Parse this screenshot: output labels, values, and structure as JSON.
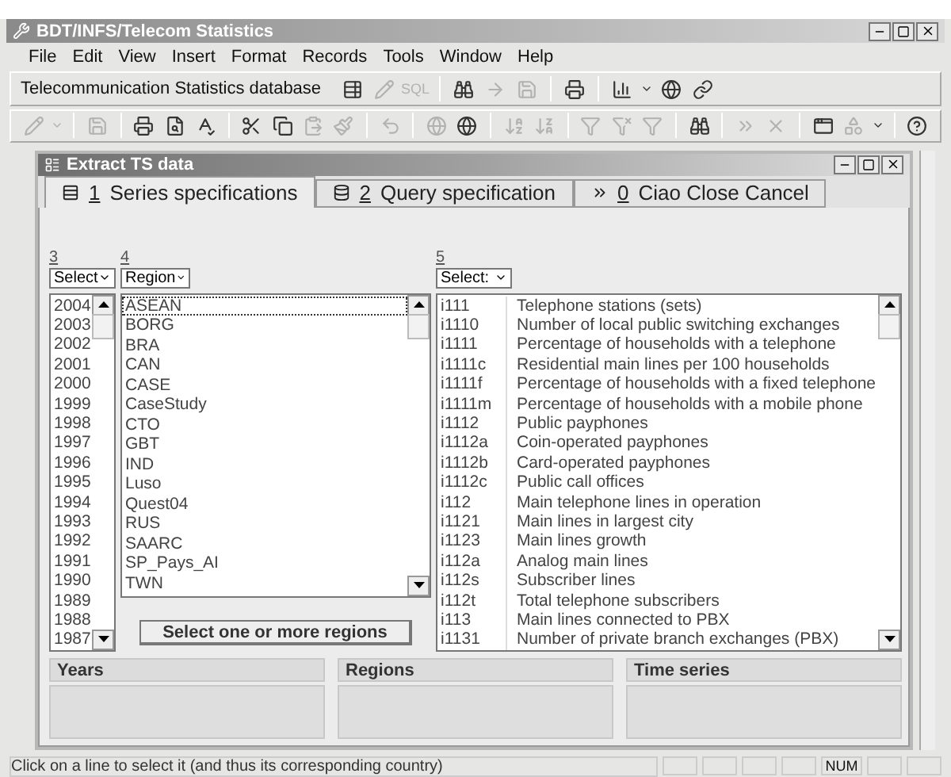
{
  "window": {
    "title": "BDT/INFS/Telecom Statistics"
  },
  "menu": [
    "File",
    "Edit",
    "View",
    "Insert",
    "Format",
    "Records",
    "Tools",
    "Window",
    "Help"
  ],
  "toolbar_1": {
    "label": "Telecommunication Statistics database",
    "items": [
      {
        "kind": "sigma",
        "disabled": false
      },
      {
        "kind": "pencil",
        "disabled": true
      },
      {
        "kind": "text",
        "label": "SQL",
        "disabled": true
      },
      {
        "kind": "separator"
      },
      {
        "kind": "binoculars",
        "disabled": false
      },
      {
        "kind": "arrow",
        "disabled": true
      },
      {
        "kind": "save",
        "disabled": true
      },
      {
        "kind": "separator"
      },
      {
        "kind": "printer",
        "disabled": false
      },
      {
        "kind": "separator"
      },
      {
        "kind": "chart",
        "disabled": false
      },
      {
        "kind": "caret",
        "disabled": false
      },
      {
        "kind": "globe",
        "disabled": false
      },
      {
        "kind": "link",
        "disabled": false
      }
    ]
  },
  "toolbar_2": {
    "items": [
      {
        "kind": "pencil",
        "disabled": true
      },
      {
        "kind": "caret",
        "disabled": true
      },
      {
        "kind": "separator"
      },
      {
        "kind": "save",
        "disabled": true
      },
      {
        "kind": "separator"
      },
      {
        "kind": "printer",
        "disabled": false
      },
      {
        "kind": "preview",
        "disabled": false
      },
      {
        "kind": "spell",
        "disabled": false
      },
      {
        "kind": "separator"
      },
      {
        "kind": "cut",
        "disabled": false
      },
      {
        "kind": "copy",
        "disabled": false
      },
      {
        "kind": "paste",
        "disabled": true
      },
      {
        "kind": "brush",
        "disabled": true
      },
      {
        "kind": "separator"
      },
      {
        "kind": "undo",
        "disabled": true
      },
      {
        "kind": "separator"
      },
      {
        "kind": "globe",
        "disabled": true
      },
      {
        "kind": "globe",
        "disabled": false
      },
      {
        "kind": "separator"
      },
      {
        "kind": "sort-az",
        "disabled": true
      },
      {
        "kind": "sort-za",
        "disabled": true
      },
      {
        "kind": "separator"
      },
      {
        "kind": "filter",
        "disabled": true
      },
      {
        "kind": "filter-form",
        "disabled": true
      },
      {
        "kind": "filter",
        "disabled": true
      },
      {
        "kind": "separator"
      },
      {
        "kind": "binoculars",
        "disabled": false
      },
      {
        "kind": "separator"
      },
      {
        "kind": "record-new",
        "disabled": true
      },
      {
        "kind": "record-delete",
        "disabled": true
      },
      {
        "kind": "separator"
      },
      {
        "kind": "windows",
        "disabled": false
      },
      {
        "kind": "new-object",
        "disabled": true
      },
      {
        "kind": "caret",
        "disabled": false
      },
      {
        "kind": "separator"
      },
      {
        "kind": "help",
        "disabled": false
      }
    ]
  },
  "child_window": {
    "title": "Extract TS data"
  },
  "tabs": [
    {
      "key": "1",
      "label": "Series specifications",
      "selected": true
    },
    {
      "key": "2",
      "label": "Query specification",
      "selected": false
    },
    {
      "key": "0",
      "label": "Ciao Close Cancel",
      "selected": false
    }
  ],
  "years": {
    "number": "3",
    "dropdown": "Select",
    "items": [
      "2004",
      "2003",
      "2002",
      "2001",
      "2000",
      "1999",
      "1998",
      "1997",
      "1996",
      "1995",
      "1994",
      "1993",
      "1992",
      "1991",
      "1990",
      "1989",
      "1988",
      "1987"
    ]
  },
  "regions": {
    "number": "4",
    "dropdown": "Region",
    "items": [
      {
        "name": "ASEAN",
        "focused": true
      },
      {
        "name": "BORG",
        "focused": false
      },
      {
        "name": "BRA",
        "focused": false
      },
      {
        "name": "CAN",
        "focused": false
      },
      {
        "name": "CASE",
        "focused": false
      },
      {
        "name": "CaseStudy",
        "focused": false
      },
      {
        "name": "CTO",
        "focused": false
      },
      {
        "name": "GBT",
        "focused": false
      },
      {
        "name": "IND",
        "focused": false
      },
      {
        "name": "Luso",
        "focused": false
      },
      {
        "name": "Quest04",
        "focused": false
      },
      {
        "name": "RUS",
        "focused": false
      },
      {
        "name": "SAARC",
        "focused": false
      },
      {
        "name": "SP_Pays_AI",
        "focused": false
      },
      {
        "name": "TWN",
        "focused": false
      }
    ],
    "button": "Select one or more regions"
  },
  "series": {
    "number": "5",
    "dropdown": "Select:",
    "items": [
      {
        "code": "i111",
        "name": "Telephone stations (sets)"
      },
      {
        "code": "i1110",
        "name": "Number of local public switching exchanges"
      },
      {
        "code": "i1111",
        "name": "Percentage of households with a telephone"
      },
      {
        "code": "i1111c",
        "name": "Residential main lines per 100 households"
      },
      {
        "code": "i1111f",
        "name": "Percentage of households with a fixed telephone"
      },
      {
        "code": "i1111m",
        "name": "Percentage of households with a mobile phone"
      },
      {
        "code": "i1112",
        "name": "Public payphones"
      },
      {
        "code": "i1112a",
        "name": "Coin-operated payphones"
      },
      {
        "code": "i1112b",
        "name": "Card-operated payphones"
      },
      {
        "code": "i1112c",
        "name": "Public call offices"
      },
      {
        "code": "i112",
        "name": "Main telephone lines in operation"
      },
      {
        "code": "i1121",
        "name": "Main lines in largest city"
      },
      {
        "code": "i1123",
        "name": "Main lines growth"
      },
      {
        "code": "i112a",
        "name": "Analog main lines"
      },
      {
        "code": "i112s",
        "name": "Subscriber lines"
      },
      {
        "code": "i112t",
        "name": "Total telephone subscribers"
      },
      {
        "code": "i113",
        "name": "Main lines connected to PBX"
      },
      {
        "code": "i1131",
        "name": "Number of private branch exchanges (PBX)"
      }
    ]
  },
  "groups": [
    "Years",
    "Regions",
    "Time series"
  ],
  "status_bar": {
    "message": "Click on a line to select it (and thus its corresponding country)",
    "indicator": "NUM"
  }
}
